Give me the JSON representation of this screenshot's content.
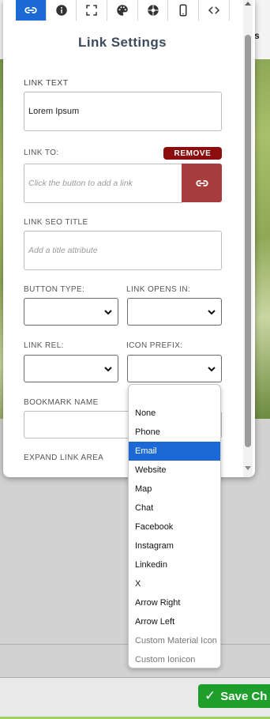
{
  "background": {
    "peek_letter": "s",
    "save_button": "Save Ch"
  },
  "panel": {
    "tabs": [
      {
        "icon": "link-icon",
        "active": true
      },
      {
        "icon": "info-icon",
        "active": false
      },
      {
        "icon": "spacing-icon",
        "active": false
      },
      {
        "icon": "palette-icon",
        "active": false
      },
      {
        "icon": "aperture-icon",
        "active": false
      },
      {
        "icon": "mobile-icon",
        "active": false
      },
      {
        "icon": "code-icon",
        "active": false
      }
    ],
    "title": "Link Settings",
    "link_text": {
      "label": "LINK TEXT",
      "value": "Lorem Ipsum"
    },
    "link_to": {
      "label": "LINK TO:",
      "placeholder": "Click the button to add a link",
      "remove": "REMOVE"
    },
    "seo_title": {
      "label": "LINK SEO TITLE",
      "placeholder": "Add a title attribute"
    },
    "button_type": {
      "label": "BUTTON TYPE:"
    },
    "opens_in": {
      "label": "LINK OPENS IN:"
    },
    "link_rel": {
      "label": "LINK REL:"
    },
    "icon_prefix": {
      "label": "ICON PREFIX:"
    },
    "bookmark": {
      "label": "BOOKMARK NAME"
    },
    "expand": {
      "label": "EXPAND LINK AREA"
    }
  },
  "dropdown": {
    "options": [
      "None",
      "Phone",
      "Email",
      "Website",
      "Map",
      "Chat",
      "Facebook",
      "Instagram",
      "Linkedin",
      "X",
      "Arrow Right",
      "Arrow Left",
      "Custom Material Icon",
      "Custom Ionicon"
    ],
    "selected": "Email",
    "colors": {
      "selected_bg": "#1b69d5",
      "remove_bg": "#8b0d0d",
      "link_btn_bg": "#a83d3d",
      "save_bg": "#1e9e2a"
    }
  }
}
